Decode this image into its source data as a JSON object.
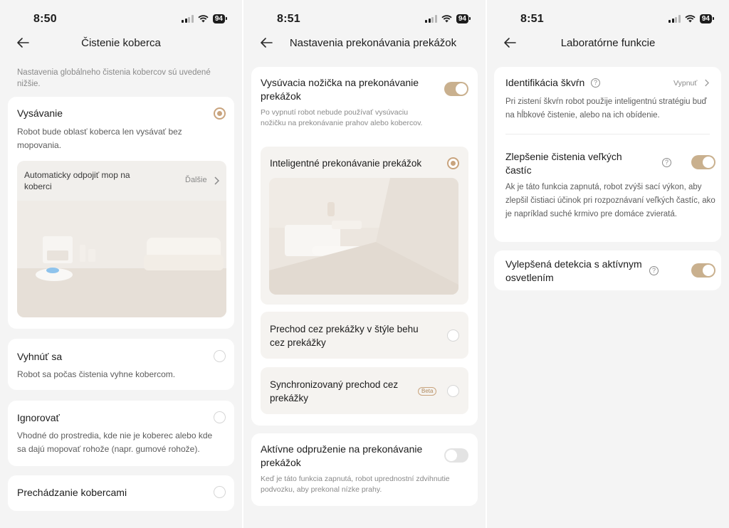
{
  "battery": "94",
  "screen1": {
    "time": "8:50",
    "title": "Čistenie koberca",
    "intro": "Nastavenia globálneho čistenia kobercov sú uvedené nižšie.",
    "options": [
      {
        "label": "Vysávanie",
        "desc": "Robot bude oblasť koberca len vysávať bez mopovania.",
        "selected": true
      },
      {
        "label": "Vyhnúť sa",
        "desc": "Robot sa počas čistenia vyhne kobercom.",
        "selected": false
      },
      {
        "label": "Ignorovať",
        "desc": "Vhodné do prostredia, kde nie je koberec alebo kde sa dajú mopovať rohože (napr. gumové rohože).",
        "selected": false
      },
      {
        "label": "Prechádzanie kobercami",
        "selected": false
      }
    ],
    "submenu": {
      "label": "Automaticky odpojiť mop na koberci",
      "action": "Ďalšie"
    }
  },
  "screen2": {
    "time": "8:51",
    "title": "Nastavenia prekonávania prekážok",
    "lift": {
      "label": "Vysúvacia nožička na prekonávanie prekážok",
      "desc": "Po vypnutí robot nebude používať vysúvaciu nožičku na prekonávanie prahov alebo kobercov.",
      "enabled": true
    },
    "modes": [
      {
        "label": "Inteligentné prekonávanie prekážok",
        "selected": true
      },
      {
        "label": "Prechod cez prekážky v štýle behu cez prekážky",
        "selected": false
      },
      {
        "label": "Synchronizovaný prechod cez prekážky",
        "badge": "Beta",
        "selected": false
      }
    ],
    "suspension": {
      "label": "Aktívne odpruženie na prekonávanie prekážok",
      "desc": "Keď je táto funkcia zapnutá, robot uprednostní zdvihnutie podvozku, aby prekonal nízke prahy.",
      "enabled": false
    }
  },
  "screen3": {
    "time": "8:51",
    "title": "Laboratórne funkcie",
    "stain": {
      "label": "Identifikácia škvŕn",
      "status": "Vypnuť",
      "desc": "Pri zistení škvŕn robot použije inteligentnú stratégiu buď na hĺbkové čistenie, alebo na ich obídenie."
    },
    "particles": {
      "label": "Zlepšenie čistenia veľkých častíc",
      "desc": "Ak je táto funkcia zapnutá, robot zvýši sací výkon, aby zlepšil čistiaci účinok pri rozpoznávaní veľkých častíc, ako je napríklad suché krmivo pre domáce zvieratá.",
      "enabled": true
    },
    "detection": {
      "label": "Vylepšená detekcia s aktívnym osvetlením",
      "enabled": true
    }
  },
  "colors": {
    "accent": "#c9a47e",
    "toggle_on": "#c9b08e",
    "background": "#f4f4f4",
    "card": "#ffffff"
  },
  "icons": [
    "back-arrow-icon",
    "chevron-right-icon",
    "help-icon",
    "signal-icon",
    "wifi-icon",
    "battery-icon"
  ]
}
